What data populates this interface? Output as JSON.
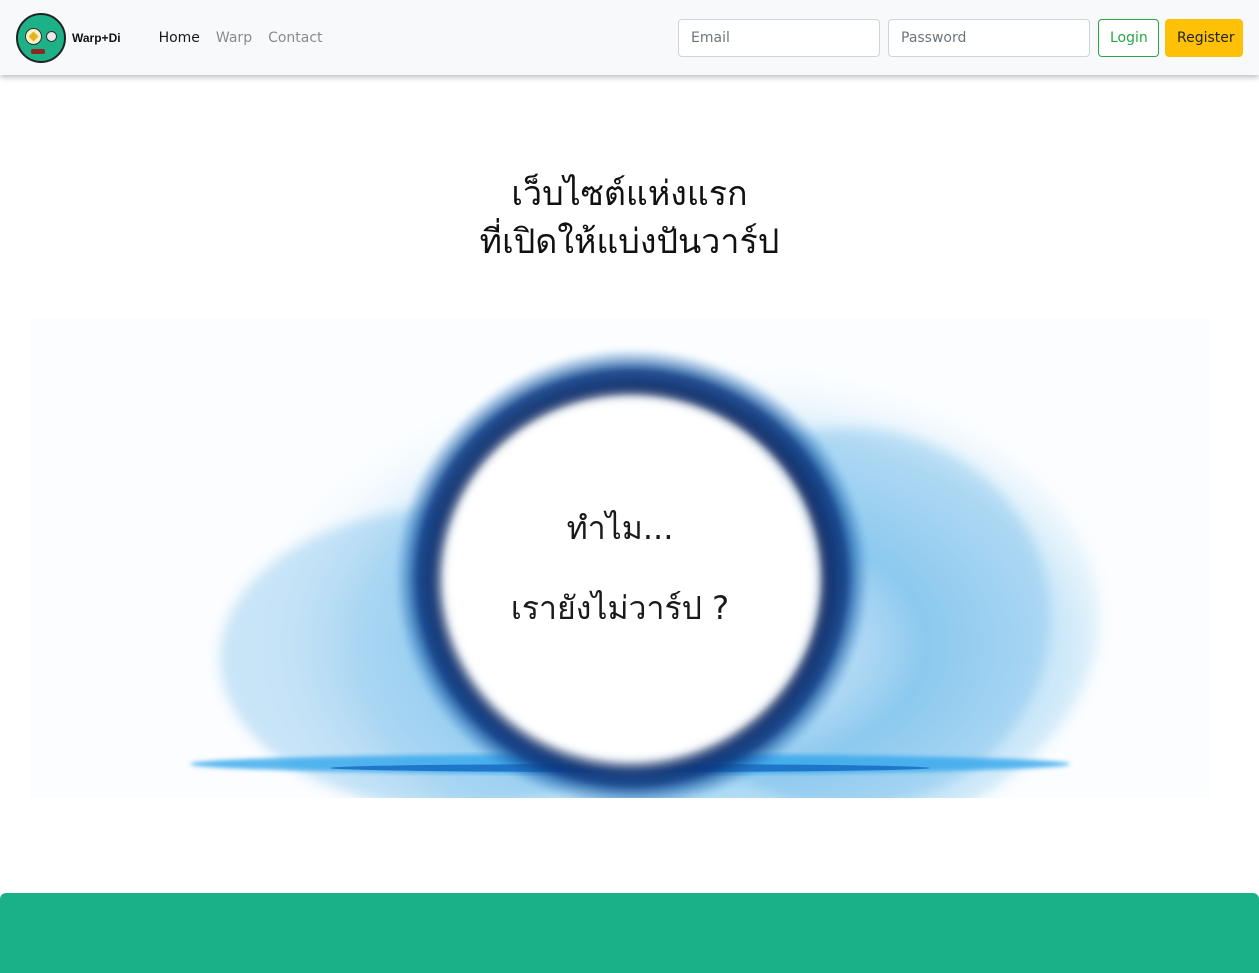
{
  "brand": {
    "name": "Warp+Di"
  },
  "nav": {
    "links": [
      {
        "label": "Home",
        "active": true
      },
      {
        "label": "Warp",
        "active": false
      },
      {
        "label": "Contact",
        "active": false
      }
    ],
    "email_placeholder": "Email",
    "password_placeholder": "Password",
    "login_label": "Login",
    "register_label": "Register"
  },
  "hero": {
    "line1": "เว็บไซต์แห่งแรก",
    "line2": "ที่เปิดให้แบ่งปันวาร์ป"
  },
  "portal": {
    "line1": "ทำไม...",
    "line2": "เรายังไม่วาร์ป ?"
  },
  "colors": {
    "accent_green": "#1ab188",
    "login_green": "#28a745",
    "register_yellow": "#ffc107",
    "portal_dark_blue": "#0a2a6b",
    "portal_light_blue": "#3fa9e8"
  },
  "icons": {
    "logo": "warp-mascot-logo"
  }
}
